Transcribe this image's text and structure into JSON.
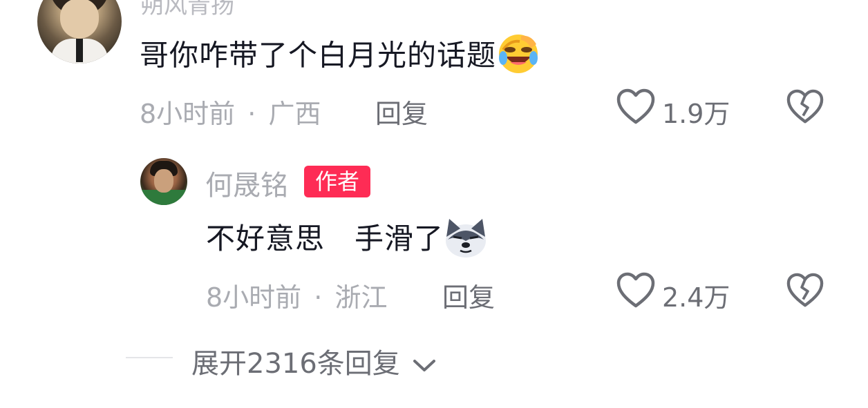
{
  "top_comment": {
    "username": "朔风青扬",
    "text": "哥你咋带了个白月光的话题",
    "emoji": "laughing-crying-emoji",
    "time": "8小时前",
    "separator": "·",
    "location": "广西",
    "reply_label": "回复",
    "like_count": "1.9万"
  },
  "author_reply": {
    "username": "何晟铭",
    "badge": "作者",
    "text": "不好意思　手滑了",
    "emoji": "husky-dog-emoji",
    "time": "8小时前",
    "separator": "·",
    "location": "浙江",
    "reply_label": "回复",
    "like_count": "2.4万"
  },
  "expand": {
    "label": "展开2316条回复"
  },
  "colors": {
    "badge": "#fe2c55",
    "text_primary": "#161823",
    "text_meta": "#a9abb1",
    "text_action": "#6c6e75"
  }
}
